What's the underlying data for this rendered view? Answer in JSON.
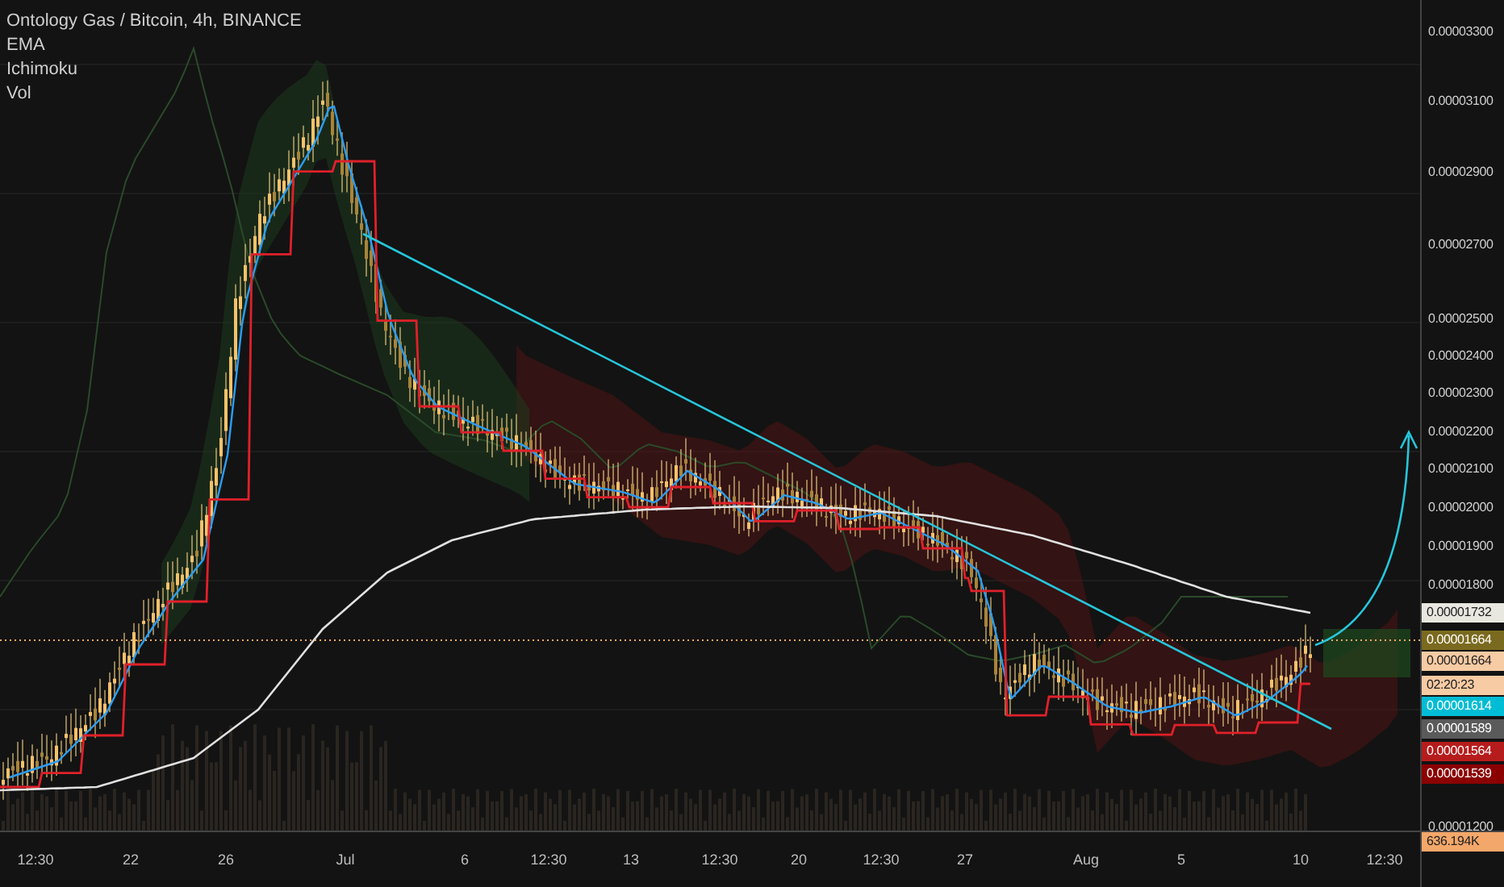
{
  "legend": {
    "title": "Ontology Gas / Bitcoin, 4h, BINANCE",
    "indicators": [
      "EMA",
      "Ichimoku",
      "Vol"
    ]
  },
  "price_axis": [
    "0.00003300",
    "0.00003100",
    "0.00002900",
    "0.00002700",
    "0.00002500",
    "0.00002400",
    "0.00002300",
    "0.00002200",
    "0.00002100",
    "0.00002000",
    "0.00001900",
    "0.00001800",
    "0.00001200"
  ],
  "price_badges": [
    {
      "label": "0.00001732",
      "color": "#e8e8e0"
    },
    {
      "label": "0.00001664",
      "color": "#7a6a1f"
    },
    {
      "label": "0.00001664",
      "color": "#f7cba3"
    },
    {
      "label": "02:20:23",
      "color": "#f7cba3"
    },
    {
      "label": "0.00001614",
      "color": "#00bcd4"
    },
    {
      "label": "0.00001589",
      "color": "#5a5a5a"
    },
    {
      "label": "0.00001564",
      "color": "#b71c1c"
    },
    {
      "label": "0.00001539",
      "color": "#8b0000"
    },
    {
      "label": "636.194K",
      "color": "#f4a76a"
    }
  ],
  "time_axis": [
    "12:30",
    "22",
    "26",
    "Jul",
    "6",
    "12:30",
    "13",
    "12:30",
    "20",
    "12:30",
    "27",
    "Aug",
    "5",
    "10",
    "12:30"
  ]
}
